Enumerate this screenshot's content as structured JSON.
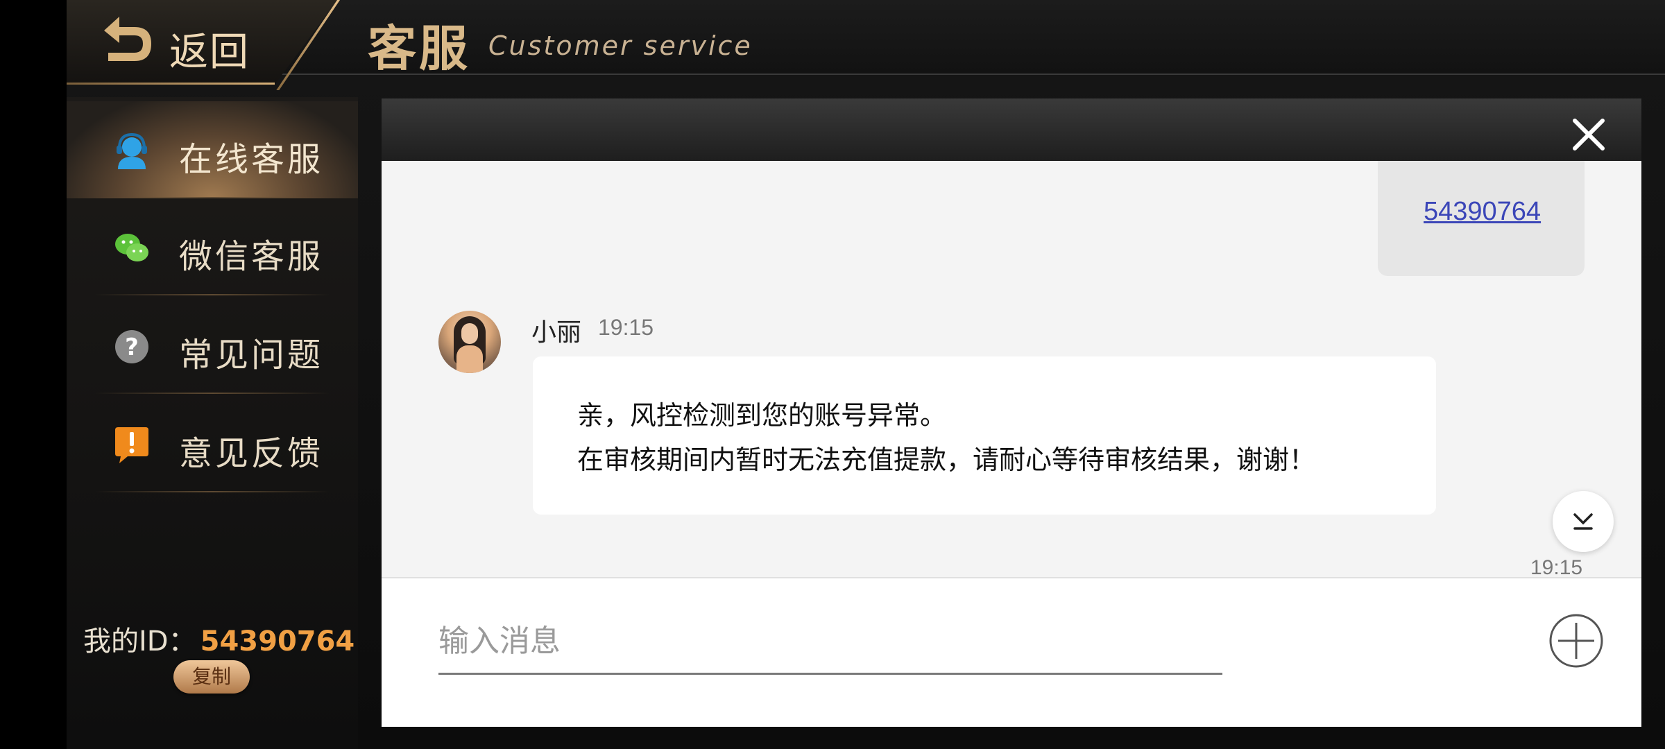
{
  "header": {
    "back_label": "返回",
    "title_cn": "客服",
    "title_en": "Customer service"
  },
  "sidebar": {
    "items": [
      {
        "label": "在线客服",
        "icon": "headset-user-icon",
        "active": true
      },
      {
        "label": "微信客服",
        "icon": "wechat-icon",
        "active": false
      },
      {
        "label": "常见问题",
        "icon": "question-icon",
        "active": false
      },
      {
        "label": "意见反馈",
        "icon": "feedback-exclamation-icon",
        "active": false
      }
    ],
    "my_id_label": "我的ID：",
    "my_id_value": "54390764",
    "copy_label": "复制"
  },
  "chat": {
    "my_message": "54390764",
    "agent_name": "小丽",
    "agent_time": "19:15",
    "agent_message_line1": "亲，风控检测到您的账号异常。",
    "agent_message_line2": "在审核期间内暂时无法充值提款，请耐心等待审核结果，谢谢！",
    "next_time": "19:15",
    "input_placeholder": "输入消息"
  },
  "colors": {
    "accent_gold": "#d9b989",
    "id_orange": "#f1a044",
    "link_blue": "#3b46b8"
  }
}
